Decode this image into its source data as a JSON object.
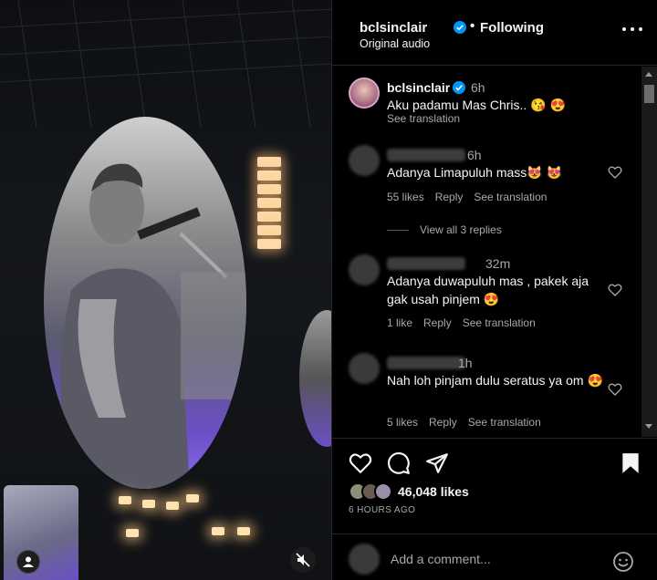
{
  "post": {
    "username": "bclsinclair",
    "follow_separator": "•",
    "follow_status": "Following",
    "audio_label": "Original audio"
  },
  "caption": {
    "username": "bclsinclair",
    "time": "6h",
    "text": "Aku padamu Mas Chris.. 😘 😍",
    "translate": "See translation"
  },
  "comments": [
    {
      "time": "6h",
      "text": "Adanya Limapuluh mass😻 😻",
      "likes": "55 likes",
      "reply": "Reply",
      "translate": "See translation"
    },
    {
      "time": "32m",
      "text": "Adanya duwapuluh mas , pakek aja gak usah pinjem 😍",
      "likes": "1 like",
      "reply": "Reply",
      "translate": "See translation"
    },
    {
      "time": "1h",
      "text": "Nah loh pinjam dulu seratus ya om 😍",
      "likes": "5 likes",
      "reply": "Reply",
      "translate": "See translation"
    }
  ],
  "view_replies": "View all 3 replies",
  "stats": {
    "likes": "46,048 likes",
    "ago": "6 HOURS AGO"
  },
  "add_comment_placeholder": "Add a comment...",
  "icons": {
    "verified": "verified-badge-icon",
    "more": "more-options-icon",
    "heart": "heart-icon",
    "comment": "comment-icon",
    "share": "share-icon",
    "save": "bookmark-icon",
    "emoji": "emoji-icon",
    "mute": "muted-speaker-icon",
    "user": "user-tag-icon"
  },
  "colors": {
    "verified": "#0095f6",
    "background": "#000000",
    "muted_text": "#a8a8a8"
  }
}
